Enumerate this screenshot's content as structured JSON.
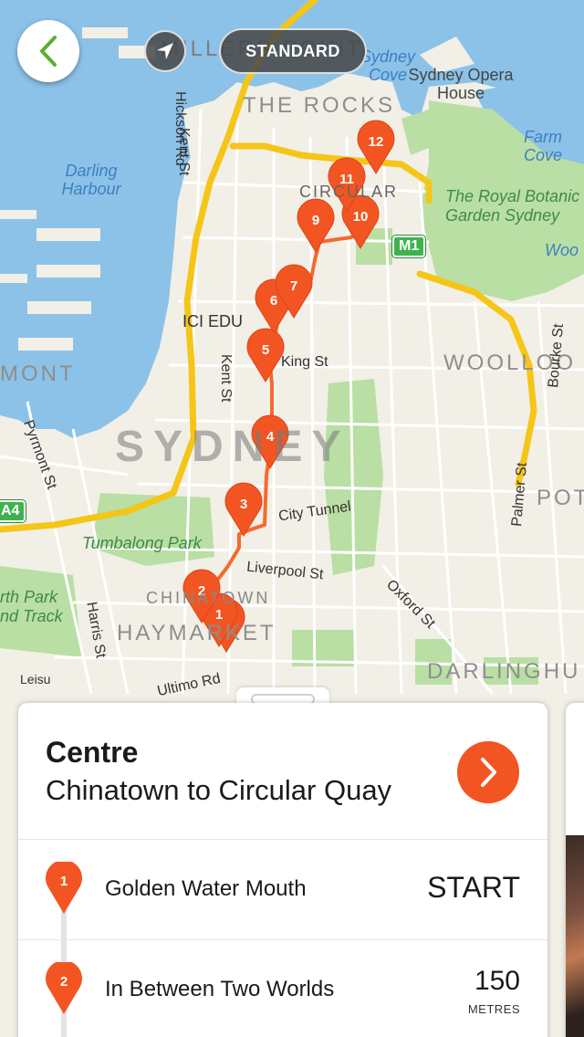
{
  "map": {
    "style_label": "STANDARD",
    "labels": {
      "millers_point": "MILLERS POINT",
      "the_rocks": "THE ROCKS",
      "sydney_cove": "Sydney Cove",
      "opera_house": "Sydney Opera House",
      "farm_cove": "Farm Cove",
      "darling_harbour": "Darling Harbour",
      "royal_botanic": "The Royal Botanic Garden Sydney",
      "woolloomooloo_w": "Woo",
      "woolloomooloo": "WOOLLOO",
      "circular": "CIRCULAR",
      "ici_edu": "ICI EDU",
      "king_st": "King St",
      "kent_st_1": "Kent St",
      "kent_st_2": "Kent St",
      "hickson_rd": "Hickson Rd",
      "pyrmont": "MONT",
      "pyrmont_st": "Pyrmont St",
      "sydney": "SYDNEY",
      "city_tunnel": "City Tunnel",
      "tumbalong": "Tumbalong Park",
      "liverpool": "Liverpool St",
      "chinatown": "CHINATOWN",
      "haymarket": "HAYMARKET",
      "harris_st": "Harris St",
      "ultimo_rd": "Ultimo Rd",
      "leisure": "Leisu",
      "north_park": "rth Park",
      "and_track": "nd Track",
      "oxford_st": "Oxford St",
      "darlinghurst": "DARLINGHU",
      "bourke_st": "Bourke St",
      "palmer_st": "Palmer St",
      "potts": "POT",
      "m1": "M1",
      "a4": "A4"
    },
    "markers": [
      "1",
      "1",
      "2",
      "3",
      "4",
      "5",
      "6",
      "7",
      "9",
      "10",
      "11",
      "12"
    ]
  },
  "colors": {
    "accent": "#f25522",
    "water": "#8cc2e8",
    "park": "#b9dfa4",
    "motorway": "#f5c518",
    "route": "#f46a2e"
  },
  "route": {
    "title": "Centre",
    "subtitle": "Chinatown to Circular Quay"
  },
  "stops": [
    {
      "number": "1",
      "name": "Golden Water Mouth",
      "distance": "START",
      "unit": ""
    },
    {
      "number": "2",
      "name": "In Between Two Worlds",
      "distance": "150",
      "unit": "METRES"
    }
  ],
  "icons": {
    "back": "chevron-left-icon",
    "locate": "location-arrow-icon",
    "next": "chevron-right-icon",
    "marker": "map-pin-icon"
  }
}
